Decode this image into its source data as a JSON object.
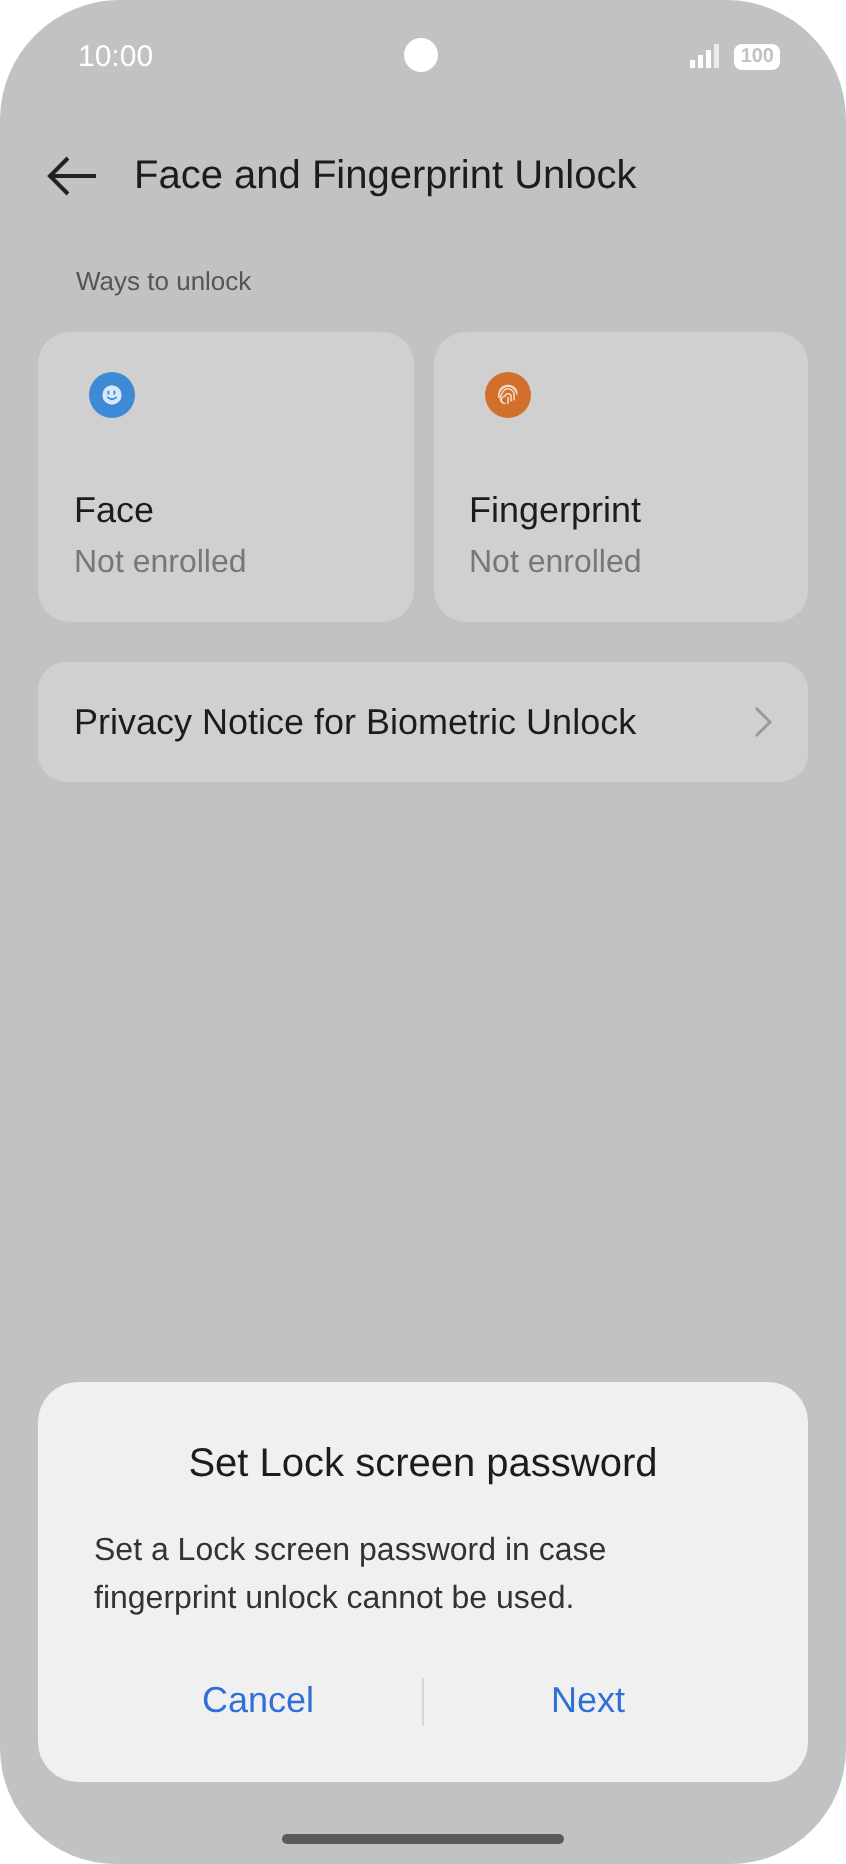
{
  "status_bar": {
    "time": "10:00",
    "battery": "100"
  },
  "header": {
    "title": "Face and Fingerprint Unlock"
  },
  "section_label": "Ways to unlock",
  "methods": [
    {
      "kind": "face",
      "title": "Face",
      "status": "Not enrolled",
      "color": "#3d8ad6"
    },
    {
      "kind": "fingerprint",
      "title": "Fingerprint",
      "status": "Not enrolled",
      "color": "#d0702c"
    }
  ],
  "privacy_row": {
    "label": "Privacy Notice for Biometric Unlock"
  },
  "dialog": {
    "title": "Set Lock screen password",
    "message": "Set a Lock screen password in case fingerprint unlock cannot be used.",
    "buttons": [
      "Cancel",
      "Next"
    ]
  }
}
